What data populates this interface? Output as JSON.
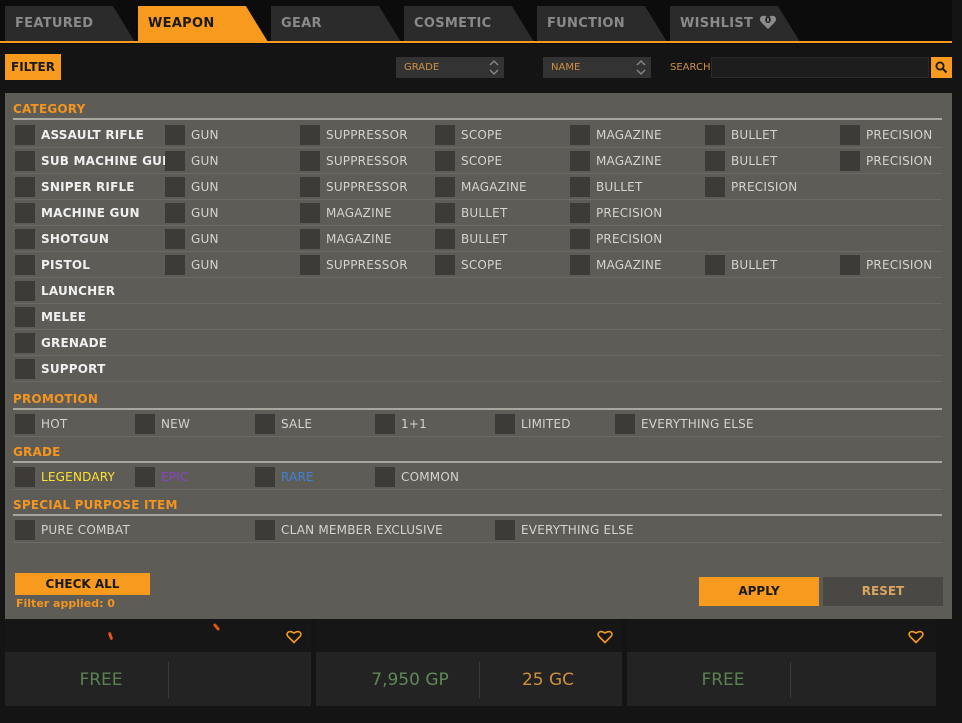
{
  "tabs": {
    "featured": "FEATURED",
    "weapon": "WEAPON",
    "gear": "GEAR",
    "cosmetic": "COSMETIC",
    "function": "FUNCTION",
    "wishlist": "WISHLIST",
    "wishlist_count": "0"
  },
  "filter_bar": {
    "filter_label": "FILTER",
    "grade_select": "GRADE",
    "name_select": "NAME",
    "search_label": "SEARCH",
    "search_value": ""
  },
  "category": {
    "title": "CATEGORY",
    "rows": [
      {
        "name": "ASSAULT RIFLE",
        "subs": [
          "GUN",
          "SUPPRESSOR",
          "SCOPE",
          "MAGAZINE",
          "BULLET",
          "PRECISION"
        ]
      },
      {
        "name": "SUB MACHINE GUN",
        "subs": [
          "GUN",
          "SUPPRESSOR",
          "SCOPE",
          "MAGAZINE",
          "BULLET",
          "PRECISION"
        ]
      },
      {
        "name": "SNIPER RIFLE",
        "subs": [
          "GUN",
          "SUPPRESSOR",
          "MAGAZINE",
          "BULLET",
          "PRECISION"
        ]
      },
      {
        "name": "MACHINE GUN",
        "subs": [
          "GUN",
          "MAGAZINE",
          "BULLET",
          "PRECISION"
        ]
      },
      {
        "name": "SHOTGUN",
        "subs": [
          "GUN",
          "MAGAZINE",
          "BULLET",
          "PRECISION"
        ]
      },
      {
        "name": "PISTOL",
        "subs": [
          "GUN",
          "SUPPRESSOR",
          "SCOPE",
          "MAGAZINE",
          "BULLET",
          "PRECISION"
        ]
      },
      {
        "name": "LAUNCHER",
        "subs": []
      },
      {
        "name": "MELEE",
        "subs": []
      },
      {
        "name": "GRENADE",
        "subs": []
      },
      {
        "name": "SUPPORT",
        "subs": []
      }
    ]
  },
  "promotion": {
    "title": "PROMOTION",
    "items": [
      "HOT",
      "NEW",
      "SALE",
      "1+1",
      "LIMITED",
      "EVERYTHING ELSE"
    ]
  },
  "grade": {
    "title": "GRADE",
    "items": [
      "LEGENDARY",
      "EPIC",
      "RARE",
      "COMMON"
    ],
    "colors": {
      "legendary": "#ffe030",
      "epic": "#8744c8",
      "rare": "#3d82d8"
    }
  },
  "special": {
    "title": "SPECIAL PURPOSE ITEM",
    "items": [
      "PURE COMBAT",
      "CLAN MEMBER EXCLUSIVE",
      "EVERYTHING ELSE"
    ]
  },
  "actions": {
    "check_all": "CHECK ALL",
    "filter_applied": "Filter applied: 0",
    "apply": "APPLY",
    "reset": "RESET"
  },
  "cards": [
    {
      "price": "FREE"
    },
    {
      "price_gp": "7,950 GP",
      "price_gc": "25 GC"
    },
    {
      "price": "FREE"
    }
  ],
  "accent_color": "#f79a1e"
}
